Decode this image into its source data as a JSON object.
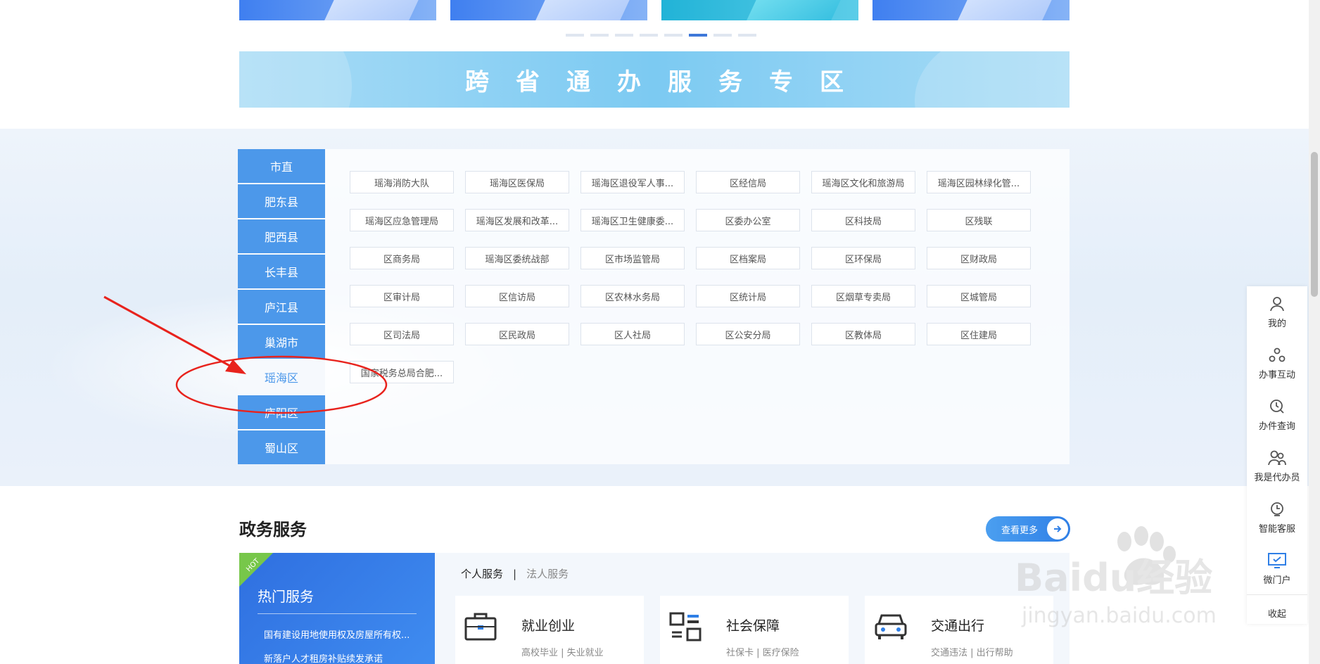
{
  "carousel": {
    "slides": [
      {
        "name": "slide-1"
      },
      {
        "name": "slide-2"
      },
      {
        "name": "slide-3"
      },
      {
        "name": "slide-4"
      }
    ],
    "dot_count": 8,
    "active_dot": 5
  },
  "zone_banner": {
    "title": "跨省通办服务专区"
  },
  "regions": {
    "tabs": [
      "市直",
      "肥东县",
      "肥西县",
      "长丰县",
      "庐江县",
      "巢湖市",
      "瑶海区",
      "庐阳区",
      "蜀山区"
    ],
    "active": 6,
    "departments": [
      "瑶海消防大队",
      "瑶海区医保局",
      "瑶海区退役军人事...",
      "区经信局",
      "瑶海区文化和旅游局",
      "瑶海区园林绿化管...",
      "瑶海区应急管理局",
      "瑶海区发展和改革...",
      "瑶海区卫生健康委...",
      "区委办公室",
      "区科技局",
      "区残联",
      "区商务局",
      "瑶海区委统战部",
      "区市场监管局",
      "区档案局",
      "区环保局",
      "区财政局",
      "区审计局",
      "区信访局",
      "区农林水务局",
      "区统计局",
      "区烟草专卖局",
      "区城管局",
      "区司法局",
      "区民政局",
      "区人社局",
      "区公安分局",
      "区教体局",
      "区住建局",
      "国家税务总局合肥..."
    ]
  },
  "sidebar": {
    "items": [
      {
        "label": "我的",
        "icon": "user-icon"
      },
      {
        "label": "办事互动",
        "icon": "interaction-icon"
      },
      {
        "label": "办件查询",
        "icon": "query-clock-icon"
      },
      {
        "label": "我是代办员",
        "icon": "agent-icon"
      },
      {
        "label": "智能客服",
        "icon": "customer-service-icon"
      },
      {
        "label": "微门户",
        "icon": "monitor-icon"
      }
    ],
    "collapse_label": "收起"
  },
  "gov_services": {
    "title": "政务服务",
    "more_label": "查看更多",
    "hot": {
      "ribbon": "HOT",
      "title": "热门服务",
      "links": [
        "国有建设用地使用权及房屋所有权...",
        "新落户人才租房补贴续发承诺"
      ]
    },
    "tabs": [
      "个人服务",
      "法人服务"
    ],
    "active_tab": 0,
    "cards": [
      {
        "name": "就业创业",
        "sub": "高校毕业 | 失业就业",
        "icon": "briefcase-icon"
      },
      {
        "name": "社会保障",
        "sub": "社保卡 | 医疗保险",
        "icon": "social-security-icon"
      },
      {
        "name": "交通出行",
        "sub": "交通违法 | 出行帮助",
        "icon": "car-icon"
      }
    ]
  },
  "watermark": {
    "brand": "Baidu经验",
    "url": "jingyan.baidu.com"
  },
  "colors": {
    "primary": "#4c98ea",
    "annotation": "#e8231d",
    "dark_blue": "#2f6fe0"
  }
}
